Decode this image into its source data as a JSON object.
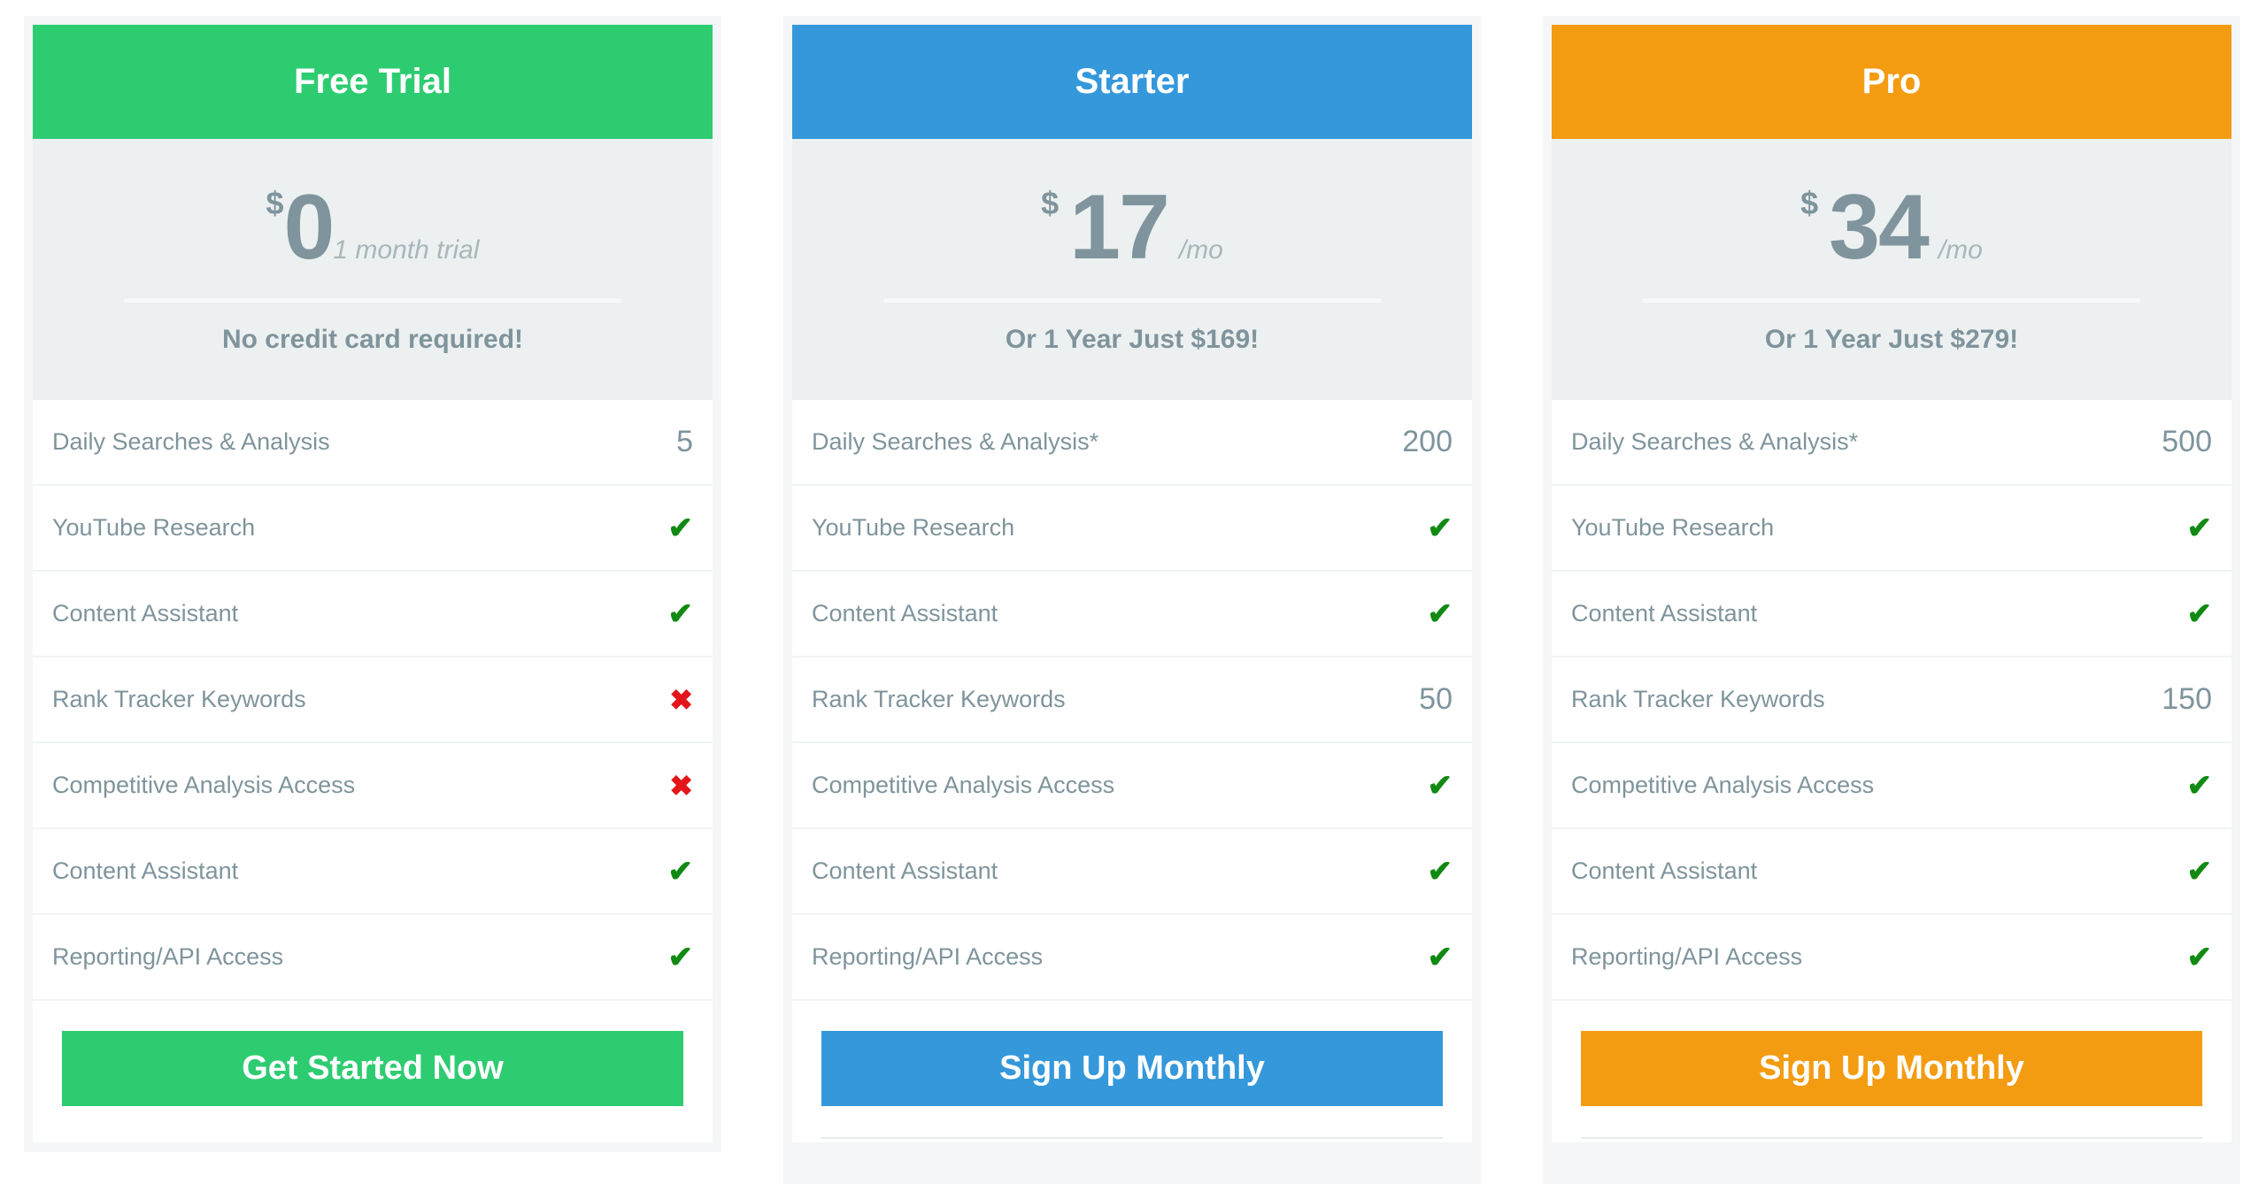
{
  "plans": [
    {
      "name": "Free Trial",
      "color": "#2ecc71",
      "currency": "$",
      "amount": "0",
      "period": "1 month trial",
      "note": "No credit card required!",
      "features": [
        {
          "label": "Daily Searches & Analysis",
          "value": "5",
          "type": "text"
        },
        {
          "label": "YouTube Research",
          "value": "✔",
          "type": "check"
        },
        {
          "label": "Content Assistant",
          "value": "✔",
          "type": "check"
        },
        {
          "label": "Rank Tracker Keywords",
          "value": "✖",
          "type": "cross"
        },
        {
          "label": "Competitive Analysis Access",
          "value": "✖",
          "type": "cross"
        },
        {
          "label": "Content Assistant",
          "value": "✔",
          "type": "check"
        },
        {
          "label": "Reporting/API Access",
          "value": "✔",
          "type": "check"
        }
      ],
      "button_label": "Get Started Now"
    },
    {
      "name": "Starter",
      "color": "#3498db",
      "currency": "$",
      "amount": "17",
      "period": "/mo",
      "note": "Or 1 Year Just $169!",
      "features": [
        {
          "label": "Daily Searches & Analysis*",
          "value": "200",
          "type": "text"
        },
        {
          "label": "YouTube Research",
          "value": "✔",
          "type": "check"
        },
        {
          "label": "Content Assistant",
          "value": "✔",
          "type": "check"
        },
        {
          "label": "Rank Tracker Keywords",
          "value": "50",
          "type": "text"
        },
        {
          "label": "Competitive Analysis Access",
          "value": "✔",
          "type": "check"
        },
        {
          "label": "Content Assistant",
          "value": "✔",
          "type": "check"
        },
        {
          "label": "Reporting/API Access",
          "value": "✔",
          "type": "check"
        }
      ],
      "button_label": "Sign Up Monthly"
    },
    {
      "name": "Pro",
      "color": "#f39c12",
      "currency": "$",
      "amount": "34",
      "period": "/mo",
      "note": "Or 1 Year Just $279!",
      "features": [
        {
          "label": "Daily Searches & Analysis*",
          "value": "500",
          "type": "text"
        },
        {
          "label": "YouTube Research",
          "value": "✔",
          "type": "check"
        },
        {
          "label": "Content Assistant",
          "value": "✔",
          "type": "check"
        },
        {
          "label": "Rank Tracker Keywords",
          "value": "150",
          "type": "text"
        },
        {
          "label": "Competitive Analysis Access",
          "value": "✔",
          "type": "check"
        },
        {
          "label": "Content Assistant",
          "value": "✔",
          "type": "check"
        },
        {
          "label": "Reporting/API Access",
          "value": "✔",
          "type": "check"
        }
      ],
      "button_label": "Sign Up Monthly"
    }
  ]
}
